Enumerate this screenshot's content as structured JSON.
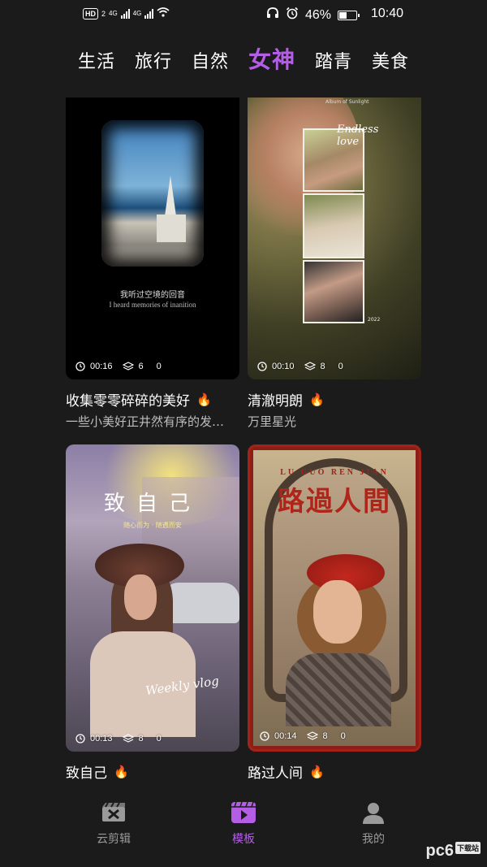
{
  "status_bar": {
    "hd": "HD",
    "sim_index": "2",
    "net1": "4G",
    "net2": "4G",
    "battery": "46%",
    "battery_level": 0.46,
    "time": "10:40"
  },
  "tabs": [
    {
      "label": "生活",
      "active": false
    },
    {
      "label": "旅行",
      "active": false
    },
    {
      "label": "自然",
      "active": false
    },
    {
      "label": "女神",
      "active": true
    },
    {
      "label": "踏青",
      "active": false
    },
    {
      "label": "美食",
      "active": false
    }
  ],
  "cards": [
    {
      "title": "收集零零碎碎的美好",
      "subtitle": "一些小美好正井然有序的发…",
      "duration": "00:16",
      "layers": "6",
      "count": "0",
      "thumb_text_cn": "我听过空境的回音",
      "thumb_text_en": "I heard memories of inanition"
    },
    {
      "title": "清澈明朗",
      "subtitle": "万里星光",
      "duration": "00:10",
      "layers": "8",
      "count": "0",
      "thumb_title": "Endless love",
      "thumb_top": "Album of Sunlight",
      "thumb_year": "2022"
    },
    {
      "title": "致自己",
      "subtitle": "",
      "duration": "00:13",
      "layers": "8",
      "count": "0",
      "thumb_title": "致自己",
      "thumb_sub": "随心而为 · 随遇而安",
      "thumb_script": "Weekly vlog"
    },
    {
      "title": "路过人间",
      "subtitle": "",
      "duration": "00:14",
      "layers": "8",
      "count": "0",
      "thumb_en": "LU GUO REN JIAN",
      "thumb_cn": "路過人間"
    }
  ],
  "fire_icon": "🔥",
  "bottom_nav": [
    {
      "label": "云剪辑",
      "icon": "clapper-icon",
      "active": false
    },
    {
      "label": "模板",
      "icon": "template-play-icon",
      "active": true
    },
    {
      "label": "我的",
      "icon": "user-icon",
      "active": false
    }
  ],
  "watermark": {
    "text": "pc6",
    "sub": "下载站"
  },
  "colors": {
    "accent": "#b45ee6",
    "background": "#1b1b1b",
    "subtitle": "#bdbdbd"
  }
}
